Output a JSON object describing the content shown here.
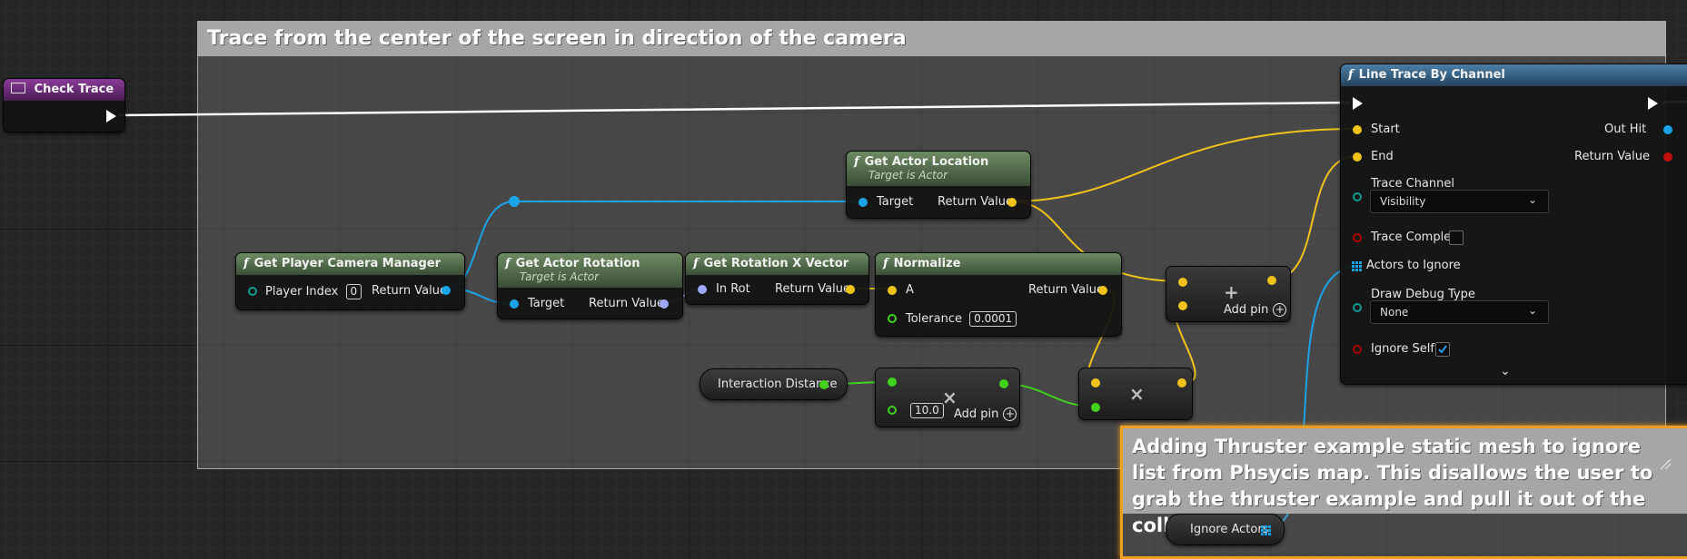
{
  "comments": {
    "trace_title": "Trace from the center of the screen in direction of the camera",
    "thruster_text": "Adding Thruster example static mesh to ignore list from Phsycis map. This disallows the user to grab the thruster example and pull it out of the collision"
  },
  "nodes": {
    "check_trace": {
      "title": "Check Trace"
    },
    "get_player_camera_manager": {
      "title": "Get Player Camera Manager",
      "player_index_label": "Player Index",
      "player_index_value": "0",
      "return_label": "Return Value"
    },
    "get_actor_rotation": {
      "title": "Get Actor Rotation",
      "subtitle": "Target is Actor",
      "target_label": "Target",
      "return_label": "Return Value"
    },
    "get_rotation_x_vector": {
      "title": "Get Rotation X Vector",
      "in_label": "In Rot",
      "return_label": "Return Value"
    },
    "get_actor_location": {
      "title": "Get Actor Location",
      "subtitle": "Target is Actor",
      "target_label": "Target",
      "return_label": "Return Value"
    },
    "normalize": {
      "title": "Normalize",
      "a_label": "A",
      "tolerance_label": "Tolerance",
      "tolerance_value": "0.0001",
      "return_label": "Return Value"
    },
    "interaction_distance": {
      "label": "Interaction Distance"
    },
    "multiply_float": {
      "value": "10.0",
      "add_pin_label": "Add pin"
    },
    "add_vector": {
      "add_pin_label": "Add pin"
    },
    "ignore_actors": {
      "label": "Ignore Actors"
    },
    "line_trace": {
      "title": "Line Trace By Channel",
      "start_label": "Start",
      "end_label": "End",
      "out_hit_label": "Out Hit",
      "return_label": "Return Value",
      "trace_channel_label": "Trace Channel",
      "trace_channel_value": "Visibility",
      "trace_complex_label": "Trace Complex",
      "actors_to_ignore_label": "Actors to Ignore",
      "draw_debug_label": "Draw Debug Type",
      "draw_debug_value": "None",
      "ignore_self_label": "Ignore Self"
    }
  },
  "colors": {
    "exec": "#ffffff",
    "vector": "#f1c31a",
    "object": "#1aa3e8",
    "rotator": "#a0a8ff",
    "float": "#40d21c",
    "bool": "#b00000",
    "byte": "#0e9c92",
    "comment_highlight": "#f0a020"
  }
}
